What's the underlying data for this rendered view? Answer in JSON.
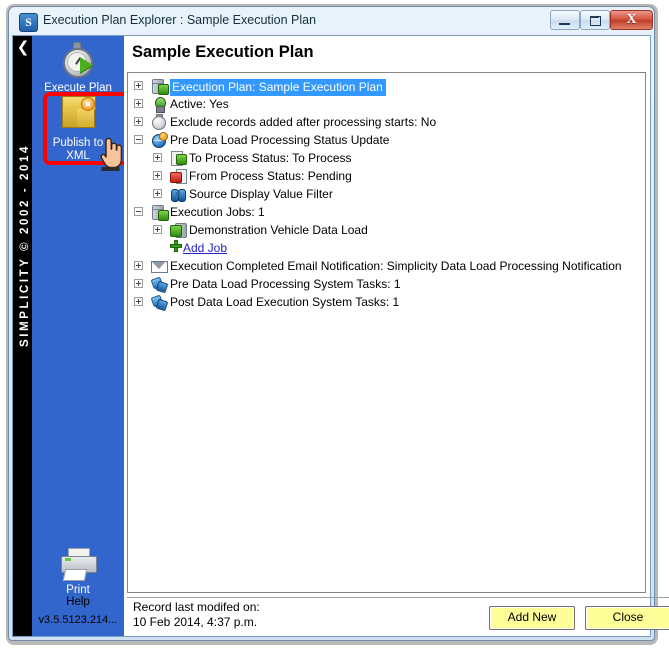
{
  "window": {
    "title": "Execution Plan Explorer : Sample Execution Plan",
    "app_icon_letter": "S",
    "minimize_label": "Minimize",
    "maximize_label": "Maximize",
    "close_label": "X"
  },
  "sidebar": {
    "collapse_icon": "❮",
    "brand_vertical": "SIMPLICITY © 2002 - 2014",
    "items": [
      {
        "label": "Execute Plan",
        "icon": "stopwatch-play-icon"
      },
      {
        "label": "Publish to\nXML",
        "label_line1": "Publish to",
        "label_line2": "XML",
        "icon": "yellow-package-icon",
        "highlighted": true
      }
    ],
    "print_label": "Print",
    "help_label": "Help",
    "version_label": "v3.5.5123.214..."
  },
  "content": {
    "page_title": "Sample Execution Plan",
    "tree": [
      {
        "indent": 0,
        "expander": "plus",
        "icon": "execution-plan-icon",
        "text": "Execution Plan:  Sample Execution Plan",
        "selected": true
      },
      {
        "indent": 0,
        "expander": "plus",
        "icon": "active-bulb-icon",
        "text": "Active:  Yes"
      },
      {
        "indent": 0,
        "expander": "plus",
        "icon": "clock-icon",
        "text": "Exclude records added after processing starts:  No"
      },
      {
        "indent": 0,
        "expander": "minus",
        "icon": "status-update-icon",
        "text": "Pre Data Load Processing Status Update"
      },
      {
        "indent": 1,
        "expander": "plus",
        "icon": "to-process-status-icon",
        "text": "To Process Status:  To Process"
      },
      {
        "indent": 1,
        "expander": "plus",
        "icon": "from-process-status-icon",
        "text": "From Process Status:  Pending"
      },
      {
        "indent": 1,
        "expander": "plus",
        "icon": "binoculars-icon",
        "text": "Source Display Value Filter"
      },
      {
        "indent": 0,
        "expander": "minus",
        "icon": "execution-jobs-icon",
        "text": "Execution Jobs:  1"
      },
      {
        "indent": 1,
        "expander": "plus",
        "icon": "data-load-job-icon",
        "text": "Demonstration Vehicle Data Load"
      },
      {
        "indent": 1,
        "expander": "none",
        "icon": "green-plus-icon",
        "text": "Add Job",
        "link": true
      },
      {
        "indent": 0,
        "expander": "plus",
        "icon": "email-icon",
        "text": "Execution Completed Email Notification:  Simplicity Data Load Processing Notification"
      },
      {
        "indent": 0,
        "expander": "plus",
        "icon": "puzzle-icon",
        "text": "Pre Data Load Processing System Tasks:  1"
      },
      {
        "indent": 0,
        "expander": "plus",
        "icon": "puzzle-icon",
        "text": "Post Data Load Execution System Tasks:  1"
      }
    ]
  },
  "statusbar": {
    "record_label": "Record last modifed on:",
    "record_timestamp": "10 Feb 2014, 4:37 p.m.",
    "add_new_label": "Add New",
    "close_label": "Close"
  },
  "colors": {
    "sidebar_blue": "#3366cc",
    "highlight_red": "#ff0000",
    "selection_blue": "#3399ff",
    "button_yellow": "#ffff99",
    "link_blue": "#2222cc"
  }
}
